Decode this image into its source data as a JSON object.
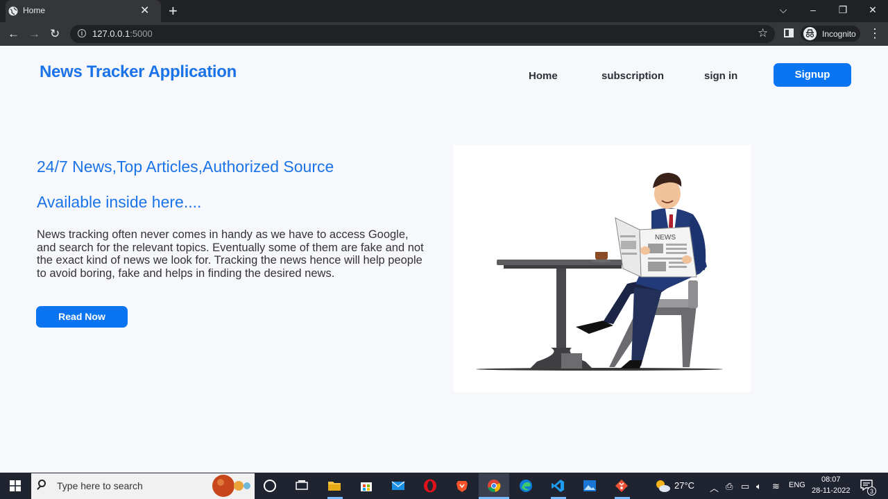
{
  "browser": {
    "tab_title": "Home",
    "url_host": "127.0.0.1",
    "url_port": ":5000",
    "profile_label": "Incognito"
  },
  "page": {
    "brand": "News Tracker Application",
    "nav": {
      "home": "Home",
      "subscription": "subscription",
      "signin": "sign in",
      "signup": "Signup"
    },
    "hero": {
      "headline": "24/7 News,Top Articles,Authorized Source",
      "subheadline": "Available inside here....",
      "paragraph": "News tracking often never comes in handy as we have to access Google, and search for the relevant topics. Eventually some of them are fake and not the exact kind of news we look for. Tracking the news hence will help people to avoid boring, fake and helps in finding the desired news.",
      "cta": "Read Now",
      "illustration_newspaper_label": "NEWS"
    },
    "colors": {
      "accent": "#1a73e8",
      "button": "#0b74f1",
      "background": "#f6f8fc"
    }
  },
  "taskbar": {
    "search_placeholder": "Type here to search",
    "temperature": "27°C",
    "language": "ENG",
    "time": "08:07",
    "date": "28-11-2022",
    "notification_count": "3",
    "icons": [
      "windows-start-icon",
      "task-view-icon",
      "widgets-icon",
      "file-explorer-icon",
      "store-icon",
      "mail-icon",
      "opera-icon",
      "brave-icon",
      "chrome-icon",
      "edge-icon",
      "vscode-icon",
      "photos-icon",
      "git-icon"
    ]
  }
}
